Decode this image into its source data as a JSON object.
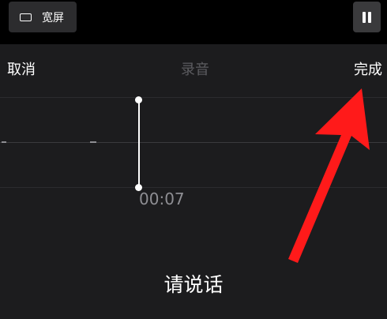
{
  "topbar": {
    "widescreen_label": "宽屏",
    "widescreen_icon": "rectangle-icon",
    "pause_icon": "pause-icon"
  },
  "nav": {
    "cancel_label": "取消",
    "title": "录音",
    "done_label": "完成"
  },
  "recording": {
    "timecode": "00:07",
    "prompt": "请说话"
  },
  "colors": {
    "background": "#1c1c1e",
    "annotation_arrow": "#ff1a1a"
  }
}
